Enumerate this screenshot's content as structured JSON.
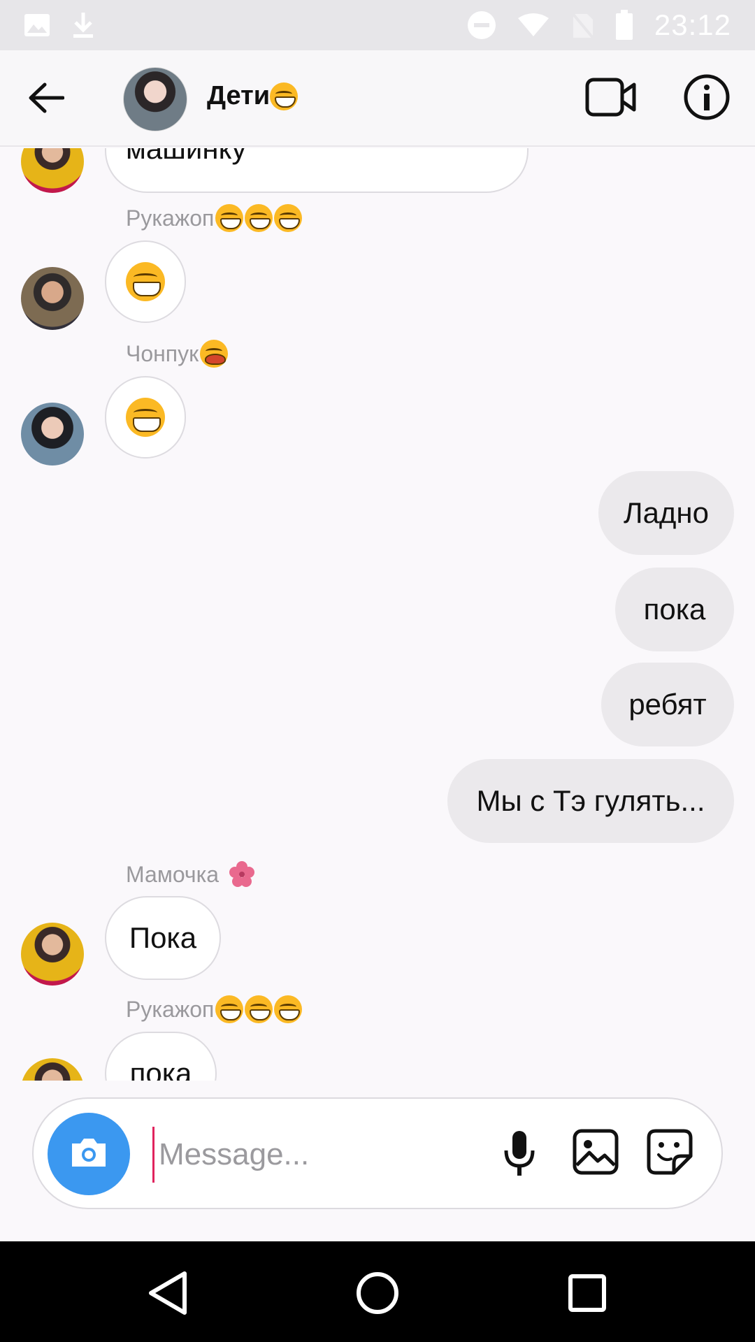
{
  "status_bar": {
    "time": "23:12",
    "left_icons": [
      "image-icon",
      "download-icon"
    ],
    "right_icons": [
      "do-not-disturb-icon",
      "wifi-icon",
      "no-sim-icon",
      "battery-icon"
    ]
  },
  "header": {
    "title": "Дети",
    "title_emoji": "grin-sweat-emoji",
    "back_icon": "back-arrow-icon",
    "video_icon": "video-call-icon",
    "info_icon": "info-icon"
  },
  "messages": [
    {
      "type": "in",
      "text": "машинку"
    },
    {
      "type": "sender",
      "name": "Рукажоп",
      "emojis": 3
    },
    {
      "type": "in-emoji",
      "text": ""
    },
    {
      "type": "sender",
      "name": "Чонпук",
      "emojis": 1
    },
    {
      "type": "in-emoji",
      "text": ""
    },
    {
      "type": "out",
      "text": "Ладно"
    },
    {
      "type": "out",
      "text": "пока"
    },
    {
      "type": "out",
      "text": "ребят"
    },
    {
      "type": "out",
      "text": "Мы с Тэ гулять..."
    },
    {
      "type": "sender",
      "name": "Мамочка",
      "emojis": 0,
      "flower": true
    },
    {
      "type": "in",
      "text": "Пока"
    },
    {
      "type": "sender",
      "name": "Рукажоп",
      "emojis": 3
    },
    {
      "type": "in",
      "text": "пока"
    }
  ],
  "chat": {
    "m1": "машинку",
    "s1": "Рукажоп",
    "s2": "Чонпук",
    "o1": "Ладно",
    "o2": "пока",
    "o3": "ребят",
    "o4": "Мы с Тэ гулять...",
    "s3": "Мамочка",
    "m2": "Пока",
    "s4": "Рукажоп",
    "m3": "пока"
  },
  "composer": {
    "placeholder": "Message...",
    "value": ""
  },
  "colors": {
    "accent_blue": "#3b98f0",
    "cursor": "#e0245e",
    "bubble_out": "#ebe9ec",
    "sender_text": "#9a999d"
  }
}
